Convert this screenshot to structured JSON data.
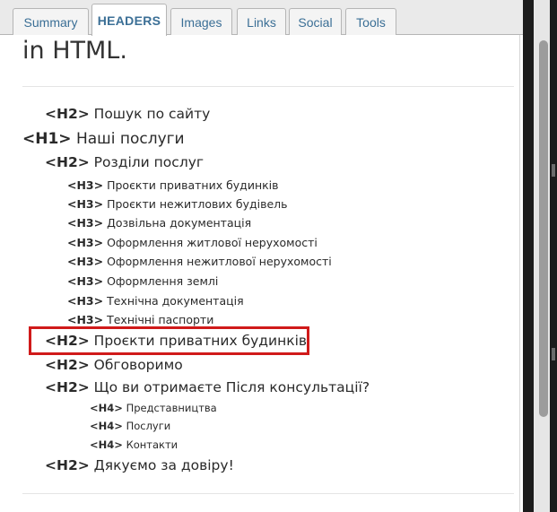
{
  "tabs": [
    {
      "label": "Summary",
      "active": false
    },
    {
      "label": "HEADERS",
      "active": true
    },
    {
      "label": "Images",
      "active": false
    },
    {
      "label": "Links",
      "active": false
    },
    {
      "label": "Social",
      "active": false
    },
    {
      "label": "Tools",
      "active": false
    }
  ],
  "content": {
    "title": "in HTML.",
    "headings": [
      {
        "tag": "<H2>",
        "text": "Пошук по сайту",
        "level": 2
      },
      {
        "tag": "<H1>",
        "text": "Наші послуги",
        "level": 1
      },
      {
        "tag": "<H2>",
        "text": "Розділи послуг",
        "level": 2
      },
      {
        "tag": "<H3>",
        "text": "Проєкти приватних будинків",
        "level": 3
      },
      {
        "tag": "<H3>",
        "text": "Проєкти нежитлових будівель",
        "level": 3
      },
      {
        "tag": "<H3>",
        "text": "Дозвільна документація",
        "level": 3
      },
      {
        "tag": "<H3>",
        "text": "Оформлення житлової нерухомості",
        "level": 3
      },
      {
        "tag": "<H3>",
        "text": "Оформлення нежитлової нерухомості",
        "level": 3
      },
      {
        "tag": "<H3>",
        "text": "Оформлення землі",
        "level": 3
      },
      {
        "tag": "<H3>",
        "text": "Технічна документація",
        "level": 3
      },
      {
        "tag": "<H3>",
        "text": "Технічні паспорти",
        "level": 3
      },
      {
        "tag": "<H2>",
        "text": "Проєкти приватних будинків",
        "level": 2,
        "highlighted": true
      },
      {
        "tag": "<H2>",
        "text": "Обговоримо",
        "level": 2
      },
      {
        "tag": "<H2>",
        "text": "Що ви отримаєте Після консультації?",
        "level": 2
      },
      {
        "tag": "<H4>",
        "text": "Представництва",
        "level": 4
      },
      {
        "tag": "<H4>",
        "text": "Послуги",
        "level": 4
      },
      {
        "tag": "<H4>",
        "text": "Контакти",
        "level": 4
      },
      {
        "tag": "<H2>",
        "text": "Дякуємо за довіру!",
        "level": 2
      }
    ]
  },
  "colors": {
    "tab_text": "#3b6f96",
    "highlight_border": "#d01a1a"
  }
}
